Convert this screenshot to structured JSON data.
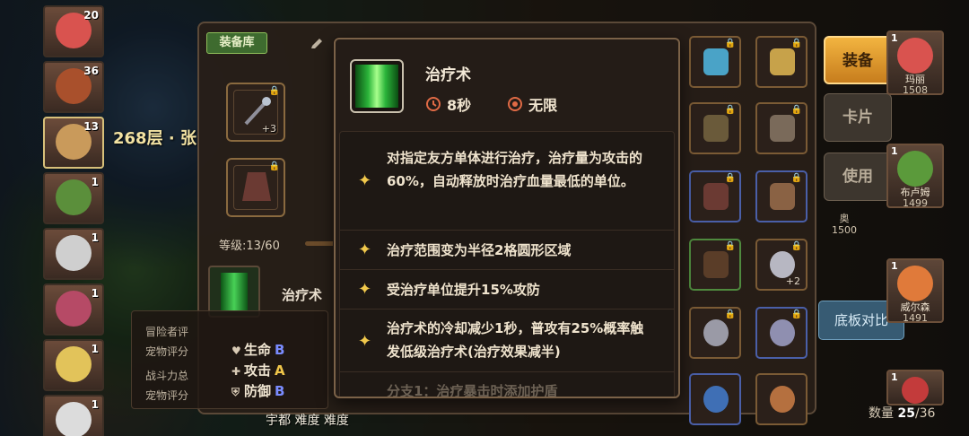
{
  "left_heroes": [
    {
      "level": "20"
    },
    {
      "level": "36"
    },
    {
      "level": "13"
    },
    {
      "level": "1"
    },
    {
      "level": "1"
    },
    {
      "level": "1"
    },
    {
      "level": "1"
    },
    {
      "level": "1"
    }
  ],
  "floor_label": "268层 · 张",
  "equipment_library_label": "装备库",
  "level_text": "等级:13/60",
  "slot_plus": "+3",
  "skill_name_left": "治疗术",
  "stats": {
    "line1": "冒险者评",
    "line2": "宠物评分",
    "line3": "战斗力总",
    "line4": "宠物评分",
    "hp_label": "生命",
    "hp_grade": "B",
    "atk_label": "攻击",
    "atk_grade": "A",
    "def_label": "防御",
    "def_grade": "B"
  },
  "stage_text": "宇都 难度 难度",
  "tooltip": {
    "title": "治疗术",
    "cooldown": "8秒",
    "range": "无限",
    "rows": [
      "对指定友方单体进行治疗，治疗量为攻击的60%，自动释放时治疗血量最低的单位。",
      "治疗范围变为半径2格圆形区域",
      "受治疗单位提升15%攻防",
      "治疗术的冷却减少1秒，普攻有25%概率触发低级治疗术(治疗效果减半)",
      "分支1：治疗暴击时添加护盾"
    ]
  },
  "side_buttons": {
    "equip": "装备",
    "card": "卡片",
    "use": "使用",
    "compare": "底板对比"
  },
  "right_heroes": [
    {
      "level": "1",
      "name": "玛丽",
      "power": "1508"
    },
    {
      "level": "1",
      "name": "布卢姆",
      "power": "1499"
    },
    {
      "level": "1",
      "name": "威尔森",
      "power": "1491"
    },
    {
      "level": "1",
      "name": "",
      "power": ""
    }
  ],
  "mid_hero": {
    "name": "奥",
    "power": "1500"
  },
  "inventory_plus": "+2",
  "count": {
    "label": "数量",
    "value": "25",
    "total": "/36"
  }
}
